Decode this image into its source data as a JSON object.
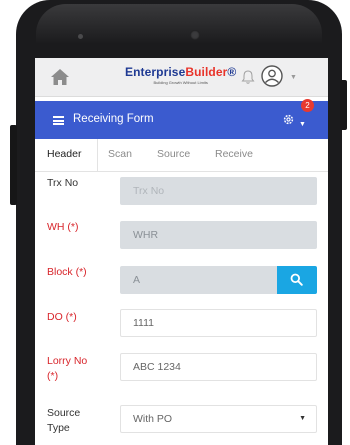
{
  "app": {
    "logo_part1": "Enterprise",
    "logo_part2": "Builder",
    "logo_mark": "®",
    "logo_tagline": "Building Growth Without Limits",
    "notification_count": "2"
  },
  "header": {
    "title": "Receiving Form"
  },
  "tabs": [
    {
      "label": "Header",
      "active": true
    },
    {
      "label": "Scan",
      "active": false
    },
    {
      "label": "Source",
      "active": false
    },
    {
      "label": "Receive",
      "active": false
    }
  ],
  "form": {
    "trx_no": {
      "label": "Trx No",
      "placeholder": "Trx No",
      "value": ""
    },
    "wh": {
      "label": "WH (*)",
      "value": "WHR"
    },
    "block": {
      "label": "Block (*)",
      "value": "A"
    },
    "do": {
      "label": "DO (*)",
      "value": "1111"
    },
    "lorry_no": {
      "label_line1": "Lorry No",
      "label_line2": "(*)",
      "value": "ABC 1234"
    },
    "source_type": {
      "label_line1": "Source",
      "label_line2": "Type",
      "value": "With PO"
    }
  },
  "colors": {
    "header_bar": "#3b5bcf",
    "search_button": "#1aa6e3",
    "required_label": "#d8252b",
    "badge": "#e8392f"
  },
  "icons": [
    "home-icon",
    "bell-icon",
    "user-icon",
    "menu-icon",
    "gear-icon",
    "search-icon",
    "caret-down-icon"
  ]
}
